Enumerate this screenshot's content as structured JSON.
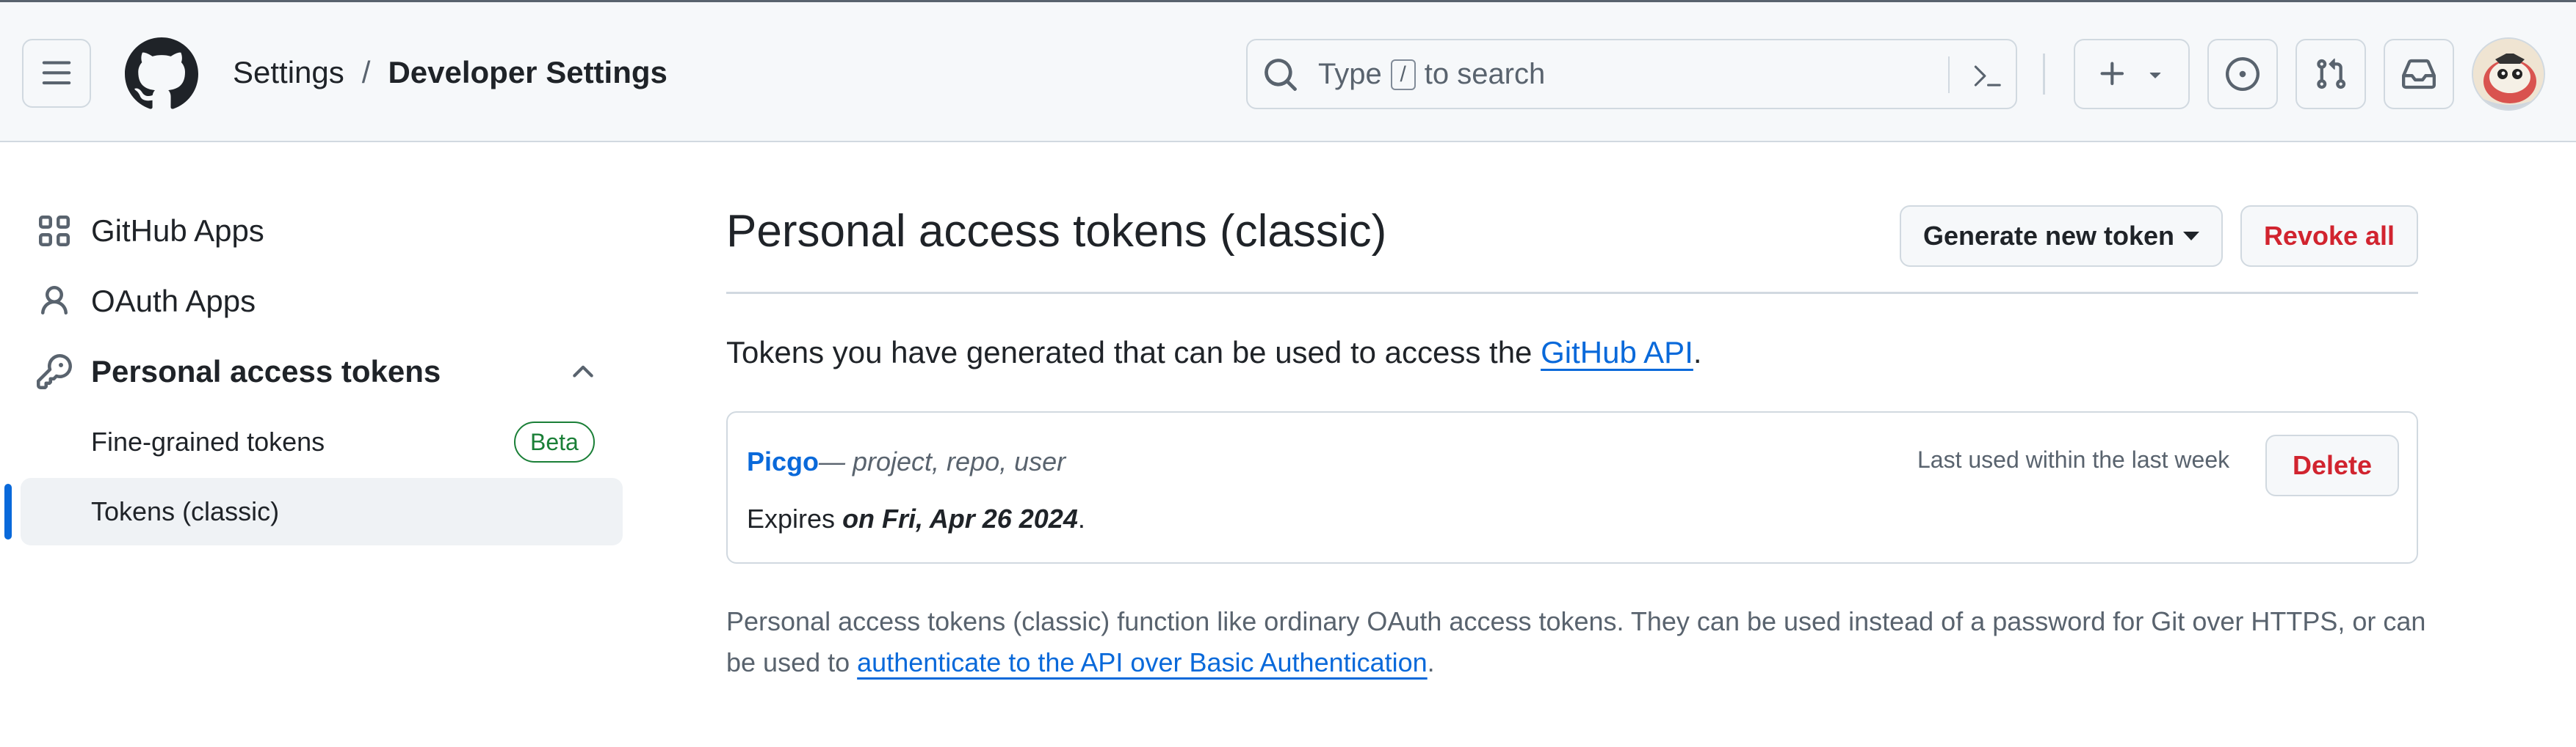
{
  "header": {
    "breadcrumb": {
      "settings": "Settings",
      "separator": "/",
      "developer": "Developer Settings"
    },
    "search": {
      "placeholder_before": "Type",
      "key": "/",
      "placeholder_after": "to search"
    },
    "icons": {
      "menu": "hamburger-menu-icon",
      "logo": "github-logo",
      "search": "search-icon",
      "command": "command-palette-icon",
      "create": "plus-icon",
      "issues": "issue-opened-icon",
      "pulls": "git-pull-request-icon",
      "inbox": "inbox-icon"
    }
  },
  "sidebar": {
    "items": [
      {
        "label": "GitHub Apps",
        "icon": "apps-grid-icon"
      },
      {
        "label": "OAuth Apps",
        "icon": "person-icon"
      },
      {
        "label": "Personal access tokens",
        "icon": "key-icon",
        "expanded": true
      },
      {
        "label": "Fine-grained tokens",
        "badge": "Beta"
      },
      {
        "label": "Tokens (classic)",
        "active": true
      }
    ]
  },
  "main": {
    "title": "Personal access tokens (classic)",
    "generate_label": "Generate new token",
    "revoke_label": "Revoke all",
    "intro_text": "Tokens you have generated that can be used to access the",
    "intro_link": "GitHub API",
    "intro_end": ".",
    "tokens": [
      {
        "name": "Picgo",
        "scopes": "— project, repo, user",
        "expires_prefix": "Expires",
        "expires_date": "on Fri, Apr 26 2024",
        "expires_suffix": ".",
        "last_used": "Last used within the last week",
        "delete_label": "Delete"
      }
    ],
    "note_text": "Personal access tokens (classic) function like ordinary OAuth access tokens. They can be used instead of a password for Git over HTTPS, or can be used to",
    "note_link": "authenticate to the API over Basic Authentication",
    "note_end": "."
  },
  "colors": {
    "accent": "#0969da",
    "danger": "#d1242f",
    "success": "#1a7f37",
    "border": "#d1d9e0",
    "header_bg": "#f6f8fa"
  }
}
